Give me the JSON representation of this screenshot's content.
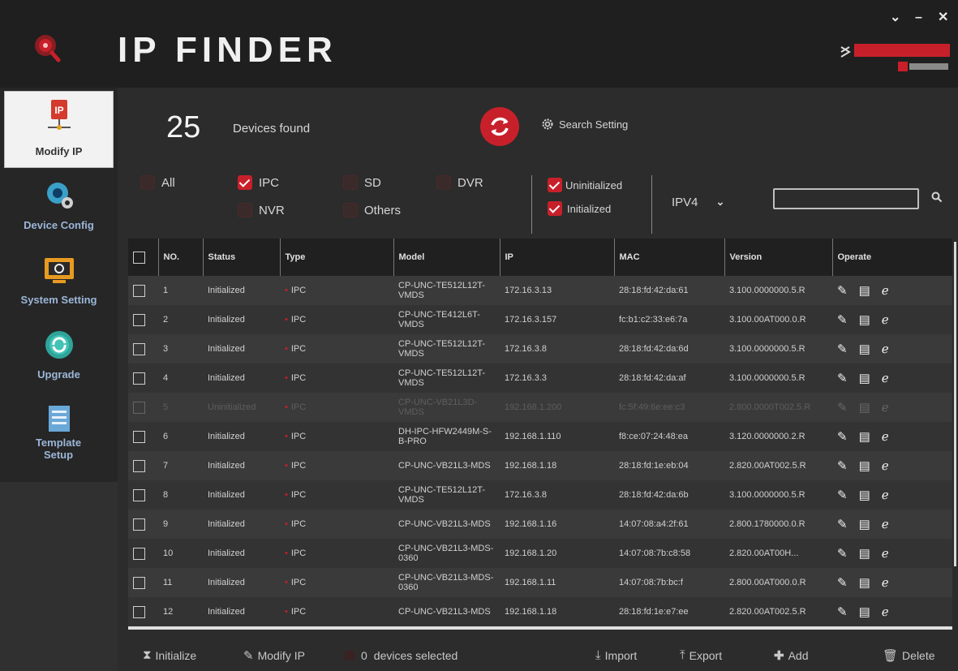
{
  "app": {
    "title": "IP FINDER",
    "accent": "#c8202a",
    "window_controls": [
      "v",
      "-",
      "x"
    ]
  },
  "sidebar": {
    "items": [
      {
        "label": "Modify IP",
        "icon": "network-ip-icon",
        "active": true
      },
      {
        "label": "Device Config",
        "icon": "camera-gear-icon",
        "active": false
      },
      {
        "label": "System Setting",
        "icon": "monitor-settings-icon",
        "active": false
      },
      {
        "label": "Upgrade",
        "icon": "refresh-circle-icon",
        "active": false
      },
      {
        "label": "Template Setup",
        "icon": "document-list-icon",
        "active": false
      }
    ]
  },
  "header": {
    "device_count": "25",
    "devices_found_label": "Devices found",
    "search_setting_label": "Search Setting"
  },
  "filters": {
    "type_options": [
      {
        "label": "All",
        "checked": false
      },
      {
        "label": "IPC",
        "checked": true
      },
      {
        "label": "SD",
        "checked": false
      },
      {
        "label": "DVR",
        "checked": false
      },
      {
        "label": "NVR",
        "checked": false
      },
      {
        "label": "Others",
        "checked": false
      }
    ],
    "state_options": [
      {
        "label": "Uninitialized",
        "checked": true
      },
      {
        "label": "Initialized",
        "checked": true
      }
    ],
    "ip_version": "IPV4",
    "search_value": ""
  },
  "table": {
    "columns": [
      "NO.",
      "Status",
      "Type",
      "Model",
      "IP",
      "MAC",
      "Version",
      "Operate"
    ],
    "rows": [
      {
        "no": "1",
        "status": "Initialized",
        "type": "IPC",
        "model": "CP-UNC-TE512L12T-VMDS",
        "ip": "172.16.3.13",
        "mac": "28:18:fd:42:da:61",
        "version": "3.100.0000000.5.R"
      },
      {
        "no": "2",
        "status": "Initialized",
        "type": "IPC",
        "model": "CP-UNC-TE412L6T-VMDS",
        "ip": "172.16.3.157",
        "mac": "fc:b1:c2:33:e6:7a",
        "version": "3.100.00AT000.0.R"
      },
      {
        "no": "3",
        "status": "Initialized",
        "type": "IPC",
        "model": "CP-UNC-TE512L12T-VMDS",
        "ip": "172.16.3.8",
        "mac": "28:18:fd:42:da:6d",
        "version": "3.100.0000000.5.R"
      },
      {
        "no": "4",
        "status": "Initialized",
        "type": "IPC",
        "model": "CP-UNC-TE512L12T-VMDS",
        "ip": "172.16.3.3",
        "mac": "28:18:fd:42:da:af",
        "version": "3.100.0000000.5.R"
      },
      {
        "no": "5",
        "status": "Uninitialized",
        "type": "IPC",
        "model": "CP-UNC-VB21L3D-VMDS",
        "ip": "192.168.1.200",
        "mac": "fc:5f:49:6e:ee:c3",
        "version": "2.800.0000T002.5.R"
      },
      {
        "no": "6",
        "status": "Initialized",
        "type": "IPC",
        "model": "DH-IPC-HFW2449M-S-B-PRO",
        "ip": "192.168.1.110",
        "mac": "f8:ce:07:24:48:ea",
        "version": "3.120.0000000.2.R"
      },
      {
        "no": "7",
        "status": "Initialized",
        "type": "IPC",
        "model": "CP-UNC-VB21L3-MDS",
        "ip": "192.168.1.18",
        "mac": "28:18:fd:1e:eb:04",
        "version": "2.820.00AT002.5.R"
      },
      {
        "no": "8",
        "status": "Initialized",
        "type": "IPC",
        "model": "CP-UNC-TE512L12T-VMDS",
        "ip": "172.16.3.8",
        "mac": "28:18:fd:42:da:6b",
        "version": "3.100.0000000.5.R"
      },
      {
        "no": "9",
        "status": "Initialized",
        "type": "IPC",
        "model": "CP-UNC-VB21L3-MDS",
        "ip": "192.168.1.16",
        "mac": "14:07:08:a4:2f:61",
        "version": "2.800.1780000.0.R"
      },
      {
        "no": "10",
        "status": "Initialized",
        "type": "IPC",
        "model": "CP-UNC-VB21L3-MDS-0360",
        "ip": "192.168.1.20",
        "mac": "14:07:08:7b:c8:58",
        "version": "2.820.00AT00H..."
      },
      {
        "no": "11",
        "status": "Initialized",
        "type": "IPC",
        "model": "CP-UNC-VB21L3-MDS-0360",
        "ip": "192.168.1.11",
        "mac": "14:07:08:7b:bc:f",
        "version": "2.800.00AT000.0.R"
      },
      {
        "no": "12",
        "status": "Initialized",
        "type": "IPC",
        "model": "CP-UNC-VB21L3-MDS",
        "ip": "192.168.1.18",
        "mac": "28:18:fd:1e:e7:ee",
        "version": "2.820.00AT002.5.R"
      }
    ]
  },
  "footer": {
    "initialize_label": "Initialize",
    "modify_ip_label": "Modify IP",
    "selected_count": "0",
    "selected_label": "devices selected",
    "import_label": "Import",
    "export_label": "Export",
    "add_label": "Add",
    "delete_label": "Delete"
  }
}
